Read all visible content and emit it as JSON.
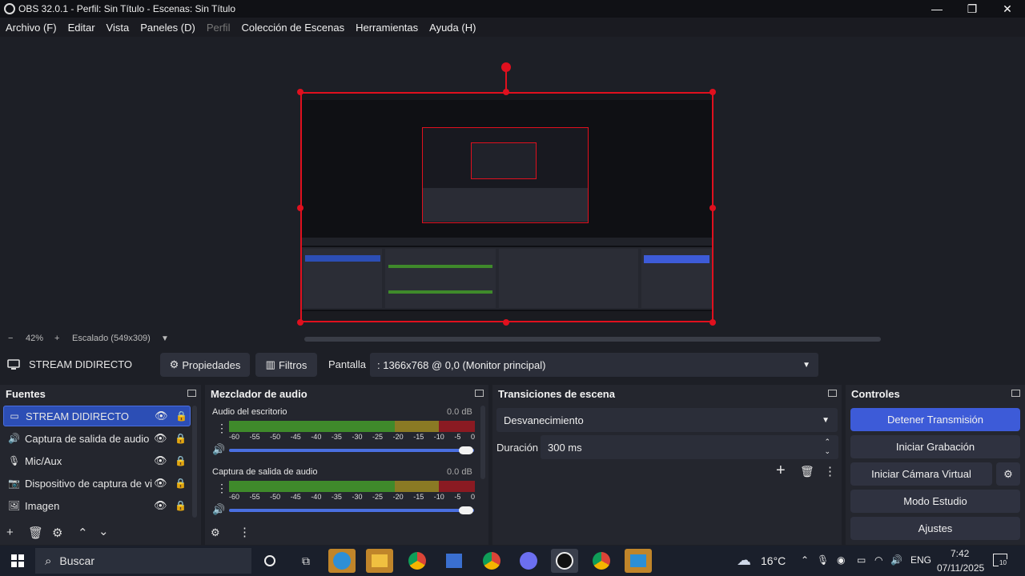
{
  "window": {
    "title": "OBS 32.0.1 - Perfil: Sin Título - Escenas: Sin Título",
    "minimize": "—",
    "maximize": "❐",
    "close": "✕"
  },
  "menu": [
    "Archivo (F)",
    "Editar",
    "Vista",
    "Paneles (D)",
    "Perfil",
    "Colección de Escenas",
    "Herramientas",
    "Ayuda (H)"
  ],
  "zoom": {
    "minus": "−",
    "value": "42%",
    "plus": "+",
    "scaling": "Escalado (549x309)",
    "dropdown": "▼"
  },
  "source_bar": {
    "selected_source": "STREAM DIDIRECTO",
    "properties_label": "Propiedades",
    "filters_label": "Filtros",
    "display_label": "Pantalla",
    "display_value": ": 1366x768 @ 0,0 (Monitor principal)"
  },
  "sources": {
    "title": "Fuentes",
    "items": [
      {
        "label": "STREAM DIDIRECTO",
        "icon": "monitor-icon",
        "selected": true
      },
      {
        "label": "Captura de salida de audio",
        "icon": "speaker-icon",
        "selected": false
      },
      {
        "label": "Mic/Aux",
        "icon": "microphone-icon",
        "selected": false
      },
      {
        "label": "Dispositivo de captura de vi",
        "icon": "camera-icon",
        "selected": false
      },
      {
        "label": "Imagen",
        "icon": "image-icon",
        "selected": false
      }
    ]
  },
  "mixer": {
    "title": "Mezclador de audio",
    "tracks": [
      {
        "name": "Audio del escritorio",
        "db": "0.0 dB",
        "volume": 1.0
      },
      {
        "name": "Captura de salida de audio",
        "db": "0.0 dB",
        "volume": 1.0
      }
    ],
    "scale": [
      "-60",
      "-55",
      "-50",
      "-45",
      "-40",
      "-35",
      "-30",
      "-25",
      "-20",
      "-15",
      "-10",
      "-5",
      "0"
    ]
  },
  "transitions": {
    "title": "Transiciones de escena",
    "selected": "Desvanecimiento",
    "duration_label": "Duración",
    "duration_value": "300 ms"
  },
  "controls": {
    "title": "Controles",
    "buttons": [
      "Detener Transmisión",
      "Iniciar Grabación",
      "Iniciar Cámara Virtual",
      "Modo Estudio",
      "Ajustes"
    ]
  },
  "taskbar": {
    "search": "Buscar",
    "weather": "16°C",
    "language": "ENG",
    "time": "7:42",
    "date": "07/11/2025",
    "notifications": "10"
  },
  "colors": {
    "accent": "#2c4eb5",
    "selection": "#e0101e",
    "stop_stream": "#3d5bd8"
  }
}
